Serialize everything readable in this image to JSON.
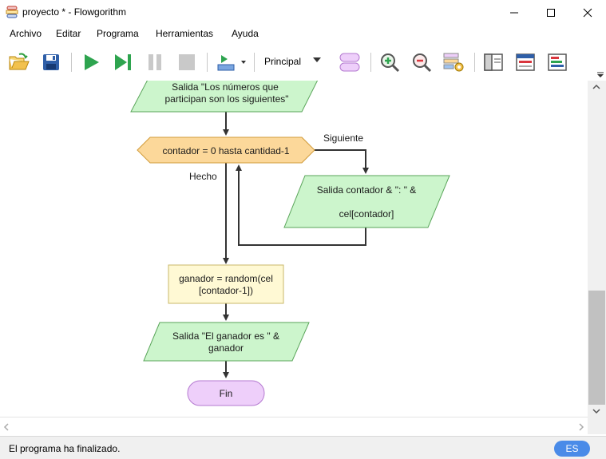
{
  "window": {
    "title": "proyecto * - Flowgorithm",
    "colors": {
      "output_fill": "#ccf5cc",
      "loop_fill": "#fcd89a",
      "assign_fill": "#fff9d4",
      "terminal_fill": "#eecffa",
      "status_badge": "#4a8be8"
    }
  },
  "menu": {
    "items": [
      "Archivo",
      "Editar",
      "Programa",
      "Herramientas",
      "Ayuda"
    ]
  },
  "toolbar": {
    "icons": [
      "open-icon",
      "save-icon",
      "run-icon",
      "step-icon",
      "pause-icon",
      "stop-icon",
      "layout-icon",
      "add-function-icon",
      "zoom-in-icon",
      "zoom-out-icon",
      "style-settings-icon",
      "panel-left-icon",
      "panel-top-icon",
      "panel-right-icon"
    ],
    "function_select": "Principal"
  },
  "flowchart": {
    "output1_line1": "Salida \"Los números que",
    "output1_line2": "participan son los siguientes\"",
    "loop_label": "contador = 0 hasta cantidad-1",
    "next_label": "Siguiente",
    "done_label": "Hecho",
    "output2_line1": "Salida contador & \": \" &",
    "output2_line2": "cel[contador]",
    "assign_line1": "ganador = random(cel",
    "assign_line2": "[contador-1])",
    "output3_line1": "Salida \"El ganador es \" &",
    "output3_line2": "ganador",
    "end_label": "Fin"
  },
  "status": {
    "message": "El programa ha finalizado.",
    "language": "ES"
  }
}
